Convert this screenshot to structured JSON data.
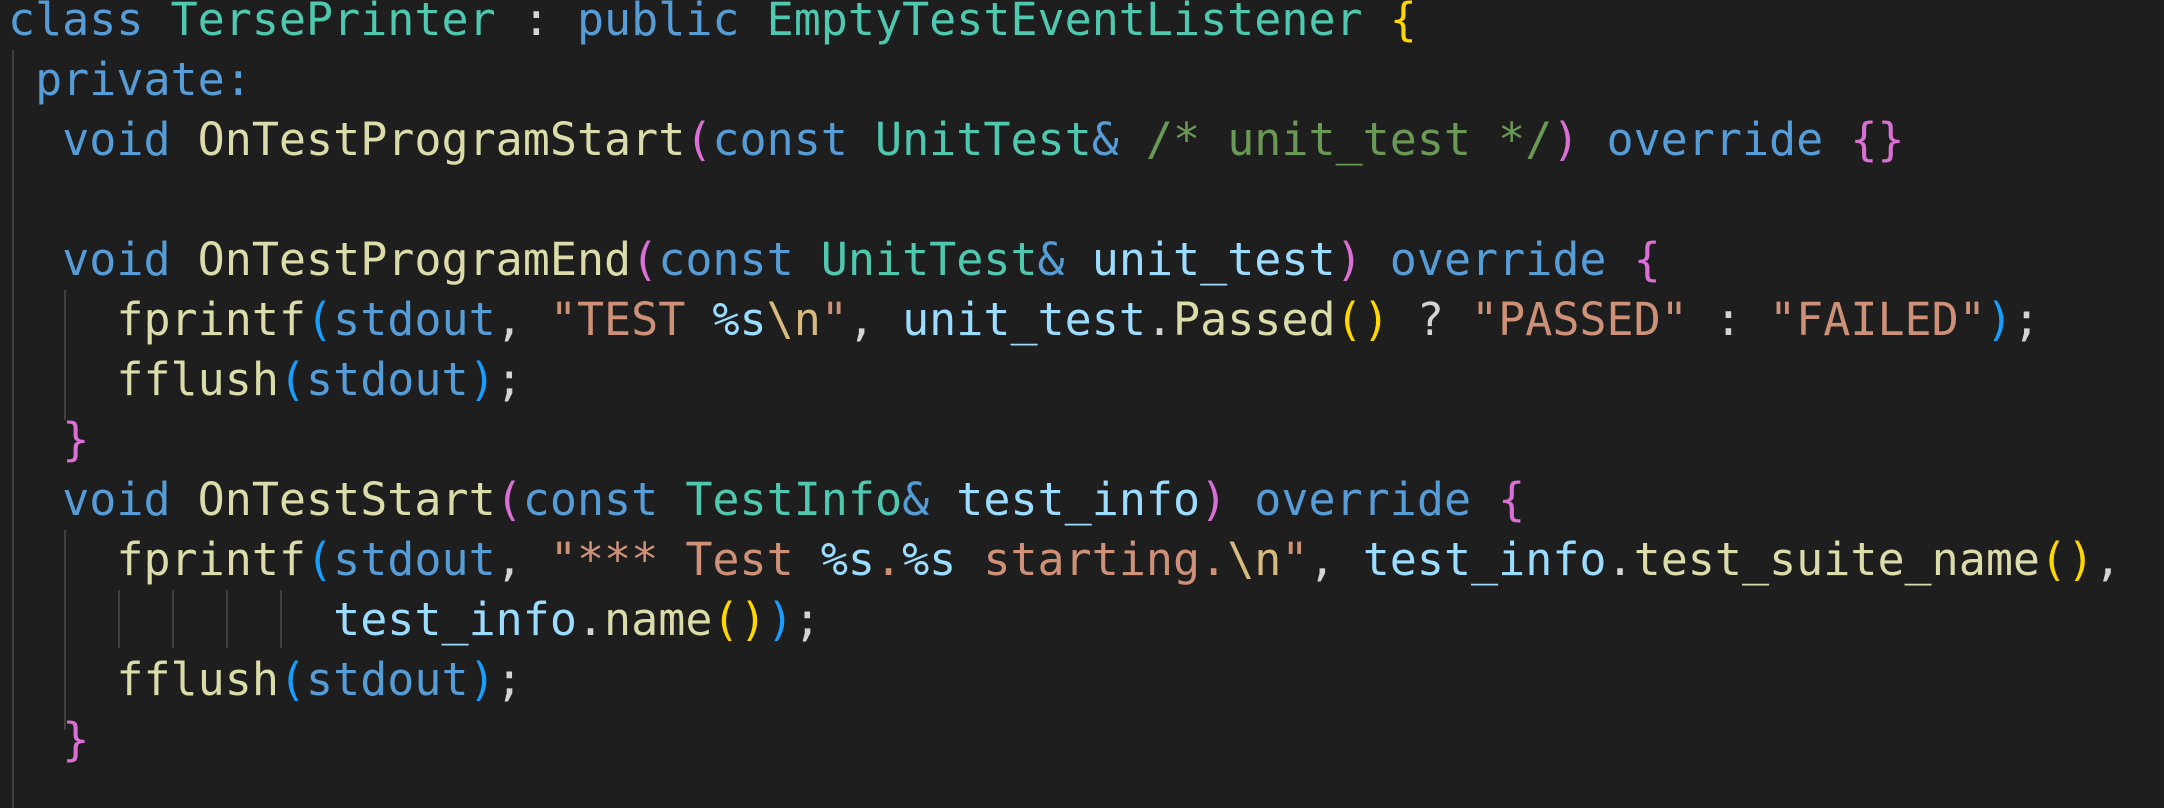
{
  "editor": {
    "lines": [
      {
        "tokens": [
          {
            "text": "class ",
            "color": "#569cd6"
          },
          {
            "text": "TersePrinter",
            "color": "#4ec9b0"
          },
          {
            "text": " : ",
            "color": "#d4d4d4"
          },
          {
            "text": "public ",
            "color": "#569cd6"
          },
          {
            "text": "EmptyTestEventListener",
            "color": "#4ec9b0"
          },
          {
            "text": " ",
            "color": "#d4d4d4"
          },
          {
            "text": "{",
            "color": "#ffd700"
          }
        ]
      },
      {
        "tokens": [
          {
            "text": " private:",
            "color": "#569cd6"
          }
        ]
      },
      {
        "tokens": [
          {
            "text": "  ",
            "color": "#d4d4d4"
          },
          {
            "text": "void ",
            "color": "#569cd6"
          },
          {
            "text": "OnTestProgramStart",
            "color": "#dcdcaa"
          },
          {
            "text": "(",
            "color": "#da70d6"
          },
          {
            "text": "const ",
            "color": "#569cd6"
          },
          {
            "text": "UnitTest",
            "color": "#4ec9b0"
          },
          {
            "text": "& ",
            "color": "#569cd6"
          },
          {
            "text": "/* unit_test */",
            "color": "#6a9955"
          },
          {
            "text": ")",
            "color": "#da70d6"
          },
          {
            "text": " ",
            "color": "#d4d4d4"
          },
          {
            "text": "override ",
            "color": "#569cd6"
          },
          {
            "text": "{}",
            "color": "#da70d6"
          }
        ]
      },
      {
        "tokens": []
      },
      {
        "tokens": [
          {
            "text": "  ",
            "color": "#d4d4d4"
          },
          {
            "text": "void ",
            "color": "#569cd6"
          },
          {
            "text": "OnTestProgramEnd",
            "color": "#dcdcaa"
          },
          {
            "text": "(",
            "color": "#da70d6"
          },
          {
            "text": "const ",
            "color": "#569cd6"
          },
          {
            "text": "UnitTest",
            "color": "#4ec9b0"
          },
          {
            "text": "& ",
            "color": "#569cd6"
          },
          {
            "text": "unit_test",
            "color": "#9cdcfe"
          },
          {
            "text": ")",
            "color": "#da70d6"
          },
          {
            "text": " ",
            "color": "#d4d4d4"
          },
          {
            "text": "override ",
            "color": "#569cd6"
          },
          {
            "text": "{",
            "color": "#da70d6"
          }
        ]
      },
      {
        "tokens": [
          {
            "text": "    ",
            "color": "#d4d4d4"
          },
          {
            "text": "fprintf",
            "color": "#dcdcaa"
          },
          {
            "text": "(",
            "color": "#179fff"
          },
          {
            "text": "stdout",
            "color": "#569cd6"
          },
          {
            "text": ", ",
            "color": "#d4d4d4"
          },
          {
            "text": "\"TEST ",
            "color": "#ce9178"
          },
          {
            "text": "%s",
            "color": "#9cdcfe"
          },
          {
            "text": "\\n",
            "color": "#d7ba7d"
          },
          {
            "text": "\"",
            "color": "#ce9178"
          },
          {
            "text": ", ",
            "color": "#d4d4d4"
          },
          {
            "text": "unit_test",
            "color": "#9cdcfe"
          },
          {
            "text": ".",
            "color": "#d4d4d4"
          },
          {
            "text": "Passed",
            "color": "#dcdcaa"
          },
          {
            "text": "()",
            "color": "#ffd700"
          },
          {
            "text": " ? ",
            "color": "#d4d4d4"
          },
          {
            "text": "\"PASSED\"",
            "color": "#ce9178"
          },
          {
            "text": " : ",
            "color": "#d4d4d4"
          },
          {
            "text": "\"FAILED\"",
            "color": "#ce9178"
          },
          {
            "text": ")",
            "color": "#179fff"
          },
          {
            "text": ";",
            "color": "#d4d4d4"
          }
        ]
      },
      {
        "tokens": [
          {
            "text": "    ",
            "color": "#d4d4d4"
          },
          {
            "text": "fflush",
            "color": "#dcdcaa"
          },
          {
            "text": "(",
            "color": "#179fff"
          },
          {
            "text": "stdout",
            "color": "#569cd6"
          },
          {
            "text": ")",
            "color": "#179fff"
          },
          {
            "text": ";",
            "color": "#d4d4d4"
          }
        ]
      },
      {
        "tokens": [
          {
            "text": "  ",
            "color": "#d4d4d4"
          },
          {
            "text": "}",
            "color": "#da70d6"
          }
        ]
      },
      {
        "tokens": [
          {
            "text": "  ",
            "color": "#d4d4d4"
          },
          {
            "text": "void ",
            "color": "#569cd6"
          },
          {
            "text": "OnTestStart",
            "color": "#dcdcaa"
          },
          {
            "text": "(",
            "color": "#da70d6"
          },
          {
            "text": "const ",
            "color": "#569cd6"
          },
          {
            "text": "TestInfo",
            "color": "#4ec9b0"
          },
          {
            "text": "& ",
            "color": "#569cd6"
          },
          {
            "text": "test_info",
            "color": "#9cdcfe"
          },
          {
            "text": ")",
            "color": "#da70d6"
          },
          {
            "text": " ",
            "color": "#d4d4d4"
          },
          {
            "text": "override ",
            "color": "#569cd6"
          },
          {
            "text": "{",
            "color": "#da70d6"
          }
        ]
      },
      {
        "tokens": [
          {
            "text": "    ",
            "color": "#d4d4d4"
          },
          {
            "text": "fprintf",
            "color": "#dcdcaa"
          },
          {
            "text": "(",
            "color": "#179fff"
          },
          {
            "text": "stdout",
            "color": "#569cd6"
          },
          {
            "text": ", ",
            "color": "#d4d4d4"
          },
          {
            "text": "\"*** Test ",
            "color": "#ce9178"
          },
          {
            "text": "%s",
            "color": "#9cdcfe"
          },
          {
            "text": ".",
            "color": "#ce9178"
          },
          {
            "text": "%s",
            "color": "#9cdcfe"
          },
          {
            "text": " starting.",
            "color": "#ce9178"
          },
          {
            "text": "\\n",
            "color": "#d7ba7d"
          },
          {
            "text": "\"",
            "color": "#ce9178"
          },
          {
            "text": ", ",
            "color": "#d4d4d4"
          },
          {
            "text": "test_info",
            "color": "#9cdcfe"
          },
          {
            "text": ".",
            "color": "#d4d4d4"
          },
          {
            "text": "test_suite_name",
            "color": "#dcdcaa"
          },
          {
            "text": "()",
            "color": "#ffd700"
          },
          {
            "text": ",",
            "color": "#d4d4d4"
          }
        ]
      },
      {
        "tokens": [
          {
            "text": "            ",
            "color": "#d4d4d4"
          },
          {
            "text": "test_info",
            "color": "#9cdcfe"
          },
          {
            "text": ".",
            "color": "#d4d4d4"
          },
          {
            "text": "name",
            "color": "#dcdcaa"
          },
          {
            "text": "()",
            "color": "#ffd700"
          },
          {
            "text": ")",
            "color": "#179fff"
          },
          {
            "text": ";",
            "color": "#d4d4d4"
          }
        ]
      },
      {
        "tokens": [
          {
            "text": "    ",
            "color": "#d4d4d4"
          },
          {
            "text": "fflush",
            "color": "#dcdcaa"
          },
          {
            "text": "(",
            "color": "#179fff"
          },
          {
            "text": "stdout",
            "color": "#569cd6"
          },
          {
            "text": ")",
            "color": "#179fff"
          },
          {
            "text": ";",
            "color": "#d4d4d4"
          }
        ]
      },
      {
        "tokens": [
          {
            "text": "  ",
            "color": "#d4d4d4"
          },
          {
            "text": "}",
            "color": "#da70d6"
          }
        ]
      }
    ]
  }
}
